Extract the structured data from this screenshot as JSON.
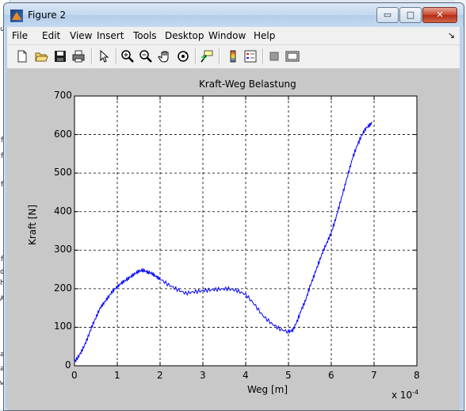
{
  "window": {
    "title": "Figure 2",
    "min_glyph": "▭",
    "max_glyph": "□",
    "close_glyph": "✕"
  },
  "menubar": {
    "items": [
      "File",
      "Edit",
      "View",
      "Insert",
      "Tools",
      "Desktop",
      "Window",
      "Help"
    ],
    "dock_glyph": "↘"
  },
  "toolbar": {
    "icons": [
      "new-figure-icon",
      "open-file-icon",
      "save-icon",
      "print-icon",
      "edit-plot-arrow-icon",
      "zoom-in-icon",
      "zoom-out-icon",
      "pan-hand-icon",
      "rotate-3d-icon",
      "data-cursor-icon",
      "insert-colorbar-icon",
      "insert-legend-icon",
      "hide-plot-tools-icon",
      "show-plot-tools-icon"
    ]
  },
  "background_left_chars": [
    "u",
    "f",
    "f",
    "f",
    "f",
    "d",
    "h",
    "A",
    "a",
    "a",
    "w"
  ],
  "chart_data": {
    "type": "line",
    "title": "Kraft-Weg Belastung",
    "xlabel": "Weg [m]",
    "ylabel": "Kraft [N]",
    "x_multiplier_label_base": "x 10",
    "x_multiplier_label_exp": "-4",
    "xlim": [
      0,
      8
    ],
    "ylim": [
      0,
      700
    ],
    "x_ticks": [
      "0",
      "1",
      "2",
      "3",
      "4",
      "5",
      "6",
      "7",
      "8"
    ],
    "y_ticks": [
      "0",
      "100",
      "200",
      "300",
      "400",
      "500",
      "600",
      "700"
    ],
    "grid": true,
    "line_color": "#0000ff",
    "series": [
      {
        "x": [
          0,
          0.1,
          0.2,
          0.3,
          0.4,
          0.5,
          0.6,
          0.7,
          0.8,
          0.9,
          1.0,
          1.1,
          1.2,
          1.3,
          1.4,
          1.5,
          1.6,
          1.7,
          1.8,
          1.9,
          2.0,
          2.2,
          2.4,
          2.6,
          2.8,
          3.0,
          3.2,
          3.4,
          3.6,
          3.8,
          4.0,
          4.2,
          4.4,
          4.6,
          4.8,
          5.0,
          5.1,
          5.2,
          5.3,
          5.4,
          5.5,
          5.6,
          5.7,
          5.8,
          5.9,
          6.0,
          6.1,
          6.2,
          6.3,
          6.4,
          6.5,
          6.6,
          6.7,
          6.8,
          6.9,
          6.95
        ],
        "y": [
          10,
          25,
          45,
          70,
          100,
          125,
          150,
          165,
          180,
          195,
          205,
          215,
          222,
          230,
          238,
          245,
          248,
          243,
          240,
          232,
          225,
          210,
          198,
          188,
          192,
          195,
          197,
          199,
          200,
          195,
          185,
          160,
          130,
          110,
          95,
          88,
          92,
          115,
          145,
          170,
          205,
          235,
          265,
          295,
          320,
          345,
          380,
          420,
          460,
          500,
          540,
          570,
          595,
          615,
          625,
          630
        ]
      }
    ]
  }
}
